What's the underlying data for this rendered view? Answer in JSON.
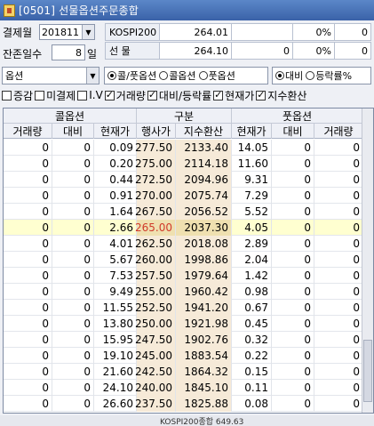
{
  "window": {
    "title": "[0501] 선물옵션주문종합"
  },
  "controls": {
    "month_label": "결제월",
    "month_value": "201811",
    "days_label": "잔존일수",
    "days_value": "8",
    "days_unit": "일",
    "type_value": "옵션"
  },
  "info": {
    "kospi_label": "KOSPI200",
    "kospi_value": "264.01",
    "kospi_pct": "0%",
    "kospi_extra": "0",
    "fut_label": "선     물",
    "fut_value": "264.10",
    "fut_change": "0",
    "fut_pct": "0%",
    "fut_extra": "0"
  },
  "radios": {
    "g1": [
      "콜/풋옵션",
      "콜옵션",
      "풋옵션"
    ],
    "g2": [
      "대비",
      "등락률%"
    ]
  },
  "checkboxes": [
    {
      "label": "증감",
      "on": false
    },
    {
      "label": "미결제",
      "on": false
    },
    {
      "label": "I.V",
      "on": false
    },
    {
      "label": "거래량",
      "on": true
    },
    {
      "label": "대비/등락률",
      "on": true
    },
    {
      "label": "현재가",
      "on": true
    },
    {
      "label": "지수환산",
      "on": true
    }
  ],
  "table": {
    "group_headers": [
      "콜옵션",
      "구분",
      "풋옵션"
    ],
    "columns": [
      "거래량",
      "대비",
      "현재가",
      "행사가",
      "지수환산",
      "현재가",
      "대비",
      "거래량"
    ],
    "highlight_row": 5,
    "rows": [
      [
        "0",
        "0",
        "0.09",
        "277.50",
        "2133.40",
        "14.05",
        "0",
        "0"
      ],
      [
        "0",
        "0",
        "0.20",
        "275.00",
        "2114.18",
        "11.60",
        "0",
        "0"
      ],
      [
        "0",
        "0",
        "0.44",
        "272.50",
        "2094.96",
        "9.31",
        "0",
        "0"
      ],
      [
        "0",
        "0",
        "0.91",
        "270.00",
        "2075.74",
        "7.29",
        "0",
        "0"
      ],
      [
        "0",
        "0",
        "1.64",
        "267.50",
        "2056.52",
        "5.52",
        "0",
        "0"
      ],
      [
        "0",
        "0",
        "2.66",
        "265.00",
        "2037.30",
        "4.05",
        "0",
        "0"
      ],
      [
        "0",
        "0",
        "4.01",
        "262.50",
        "2018.08",
        "2.89",
        "0",
        "0"
      ],
      [
        "0",
        "0",
        "5.67",
        "260.00",
        "1998.86",
        "2.04",
        "0",
        "0"
      ],
      [
        "0",
        "0",
        "7.53",
        "257.50",
        "1979.64",
        "1.42",
        "0",
        "0"
      ],
      [
        "0",
        "0",
        "9.49",
        "255.00",
        "1960.42",
        "0.98",
        "0",
        "0"
      ],
      [
        "0",
        "0",
        "11.55",
        "252.50",
        "1941.20",
        "0.67",
        "0",
        "0"
      ],
      [
        "0",
        "0",
        "13.80",
        "250.00",
        "1921.98",
        "0.45",
        "0",
        "0"
      ],
      [
        "0",
        "0",
        "15.95",
        "247.50",
        "1902.76",
        "0.32",
        "0",
        "0"
      ],
      [
        "0",
        "0",
        "19.10",
        "245.00",
        "1883.54",
        "0.22",
        "0",
        "0"
      ],
      [
        "0",
        "0",
        "21.60",
        "242.50",
        "1864.32",
        "0.15",
        "0",
        "0"
      ],
      [
        "0",
        "0",
        "24.10",
        "240.00",
        "1845.10",
        "0.11",
        "0",
        "0"
      ],
      [
        "0",
        "0",
        "26.60",
        "237.50",
        "1825.88",
        "0.08",
        "0",
        "0"
      ]
    ]
  },
  "statusbar": {
    "text": "KOSPI200종합 649.63"
  }
}
